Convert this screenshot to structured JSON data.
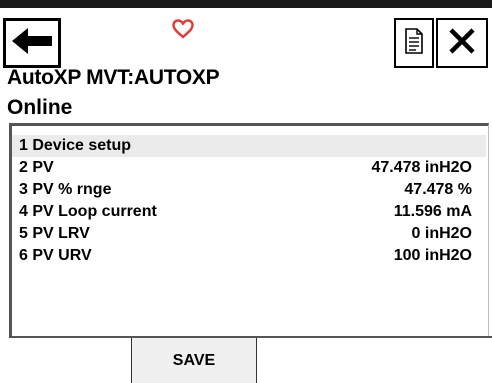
{
  "header": {
    "back_icon": "arrow-left-icon",
    "favorite_icon": "heart-outline-icon",
    "favorite_color": "#e53935",
    "document_icon": "document-icon",
    "close_icon": "close-icon"
  },
  "device_title": "AutoXP MVT:AUTOXP",
  "status": "Online",
  "menu": {
    "items": [
      {
        "label": "1 Device setup",
        "value": ""
      },
      {
        "label": "2 PV",
        "value": "47.478 inH2O"
      },
      {
        "label": "3 PV % rnge",
        "value": "47.478 %"
      },
      {
        "label": "4 PV Loop current",
        "value": "11.596 mA"
      },
      {
        "label": "5 PV LRV",
        "value": "0 inH2O"
      },
      {
        "label": "6 PV URV",
        "value": "100 inH2O"
      }
    ]
  },
  "footer": {
    "save_label": "SAVE"
  }
}
